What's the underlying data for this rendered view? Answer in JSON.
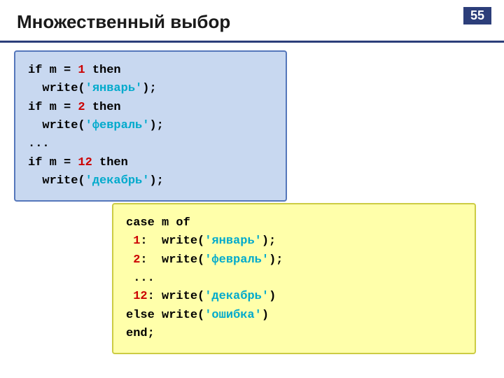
{
  "page": {
    "number": "55",
    "title": "Множественный выбор"
  },
  "codeBlue": {
    "lines": [
      {
        "parts": [
          {
            "text": "if m = ",
            "color": "black"
          },
          {
            "text": "1",
            "color": "red"
          },
          {
            "text": " then",
            "color": "black"
          }
        ]
      },
      {
        "parts": [
          {
            "text": "  write(",
            "color": "black"
          },
          {
            "text": "'январь'",
            "color": "cyan"
          },
          {
            "text": ");",
            "color": "black"
          }
        ]
      },
      {
        "parts": [
          {
            "text": "if m = ",
            "color": "black"
          },
          {
            "text": "2",
            "color": "red"
          },
          {
            "text": " then",
            "color": "black"
          }
        ]
      },
      {
        "parts": [
          {
            "text": "  write(",
            "color": "black"
          },
          {
            "text": "'февраль'",
            "color": "cyan"
          },
          {
            "text": ");",
            "color": "black"
          }
        ]
      },
      {
        "parts": [
          {
            "text": "...",
            "color": "black"
          }
        ]
      },
      {
        "parts": [
          {
            "text": "if m = ",
            "color": "black"
          },
          {
            "text": "12",
            "color": "red"
          },
          {
            "text": " then",
            "color": "black"
          }
        ]
      },
      {
        "parts": [
          {
            "text": "  write(",
            "color": "black"
          },
          {
            "text": "'декабрь'",
            "color": "cyan"
          },
          {
            "text": ");",
            "color": "black"
          }
        ]
      }
    ]
  },
  "codeYellow": {
    "lines": [
      {
        "parts": [
          {
            "text": "case m of",
            "color": "black"
          }
        ]
      },
      {
        "parts": [
          {
            "text": " ",
            "color": "black"
          },
          {
            "text": "1",
            "color": "red"
          },
          {
            "text": ":  write(",
            "color": "black"
          },
          {
            "text": "'январь'",
            "color": "cyan"
          },
          {
            "text": ");",
            "color": "black"
          }
        ]
      },
      {
        "parts": [
          {
            "text": " ",
            "color": "black"
          },
          {
            "text": "2",
            "color": "red"
          },
          {
            "text": ":  write(",
            "color": "black"
          },
          {
            "text": "'февраль'",
            "color": "cyan"
          },
          {
            "text": ");",
            "color": "black"
          }
        ]
      },
      {
        "parts": [
          {
            "text": " ...",
            "color": "black"
          }
        ]
      },
      {
        "parts": [
          {
            "text": " ",
            "color": "black"
          },
          {
            "text": "12",
            "color": "red"
          },
          {
            "text": ": write(",
            "color": "black"
          },
          {
            "text": "'декабрь'",
            "color": "cyan"
          },
          {
            "text": ")",
            "color": "black"
          }
        ]
      },
      {
        "parts": [
          {
            "text": "else write(",
            "color": "black"
          },
          {
            "text": "'ошибка'",
            "color": "cyan"
          },
          {
            "text": ")",
            "color": "black"
          }
        ]
      },
      {
        "parts": [
          {
            "text": "end;",
            "color": "black"
          }
        ]
      }
    ]
  }
}
